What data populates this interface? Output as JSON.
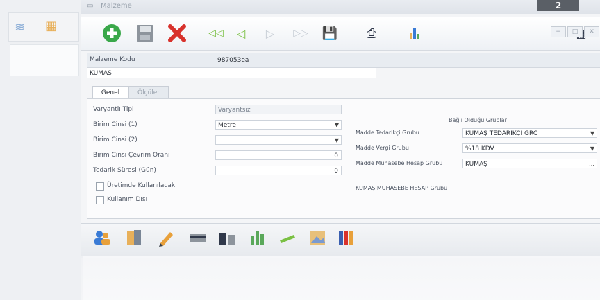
{
  "window": {
    "title": "Malzeme",
    "badge": "2"
  },
  "header": {
    "code_label": "Malzeme Kodu",
    "code_value": "987053ea",
    "name_value": "KUMAŞ"
  },
  "tabs": [
    {
      "label": "Genel"
    },
    {
      "label": "Ölçüler"
    }
  ],
  "left_form": {
    "variant_type_label": "Varyantlı Tipi",
    "variant_type_value": "Varyantsız",
    "unit1_label": "Birim Cinsi (1)",
    "unit1_value": "Metre",
    "unit2_label": "Birim Cinsi (2)",
    "unit2_value": "",
    "conv_label": "Birim Cinsi Çevrim Oranı",
    "conv_value": "0",
    "lead_label": "Tedarik Süresi (Gün)",
    "lead_value": "0",
    "cb1_label": "Üretimde Kullanılacak",
    "cb2_label": "Kullanım Dışı"
  },
  "right_form": {
    "group_title": "Bağlı Olduğu Gruplar",
    "supply_label": "Madde Tedarikçi Grubu",
    "supply_value": "KUMAŞ TEDARİKÇİ GRC",
    "tax_label": "Madde Vergi Grubu",
    "tax_value": "%18 KDV",
    "acc_label": "Madde Muhasebe Hesap Grubu",
    "acc_value": "KUMAŞ",
    "acc_note": "KUMAŞ MUHASEBE HESAP Grubu"
  },
  "icons": {
    "toolbar": [
      "add-icon",
      "save-icon",
      "delete-icon",
      "first-icon",
      "prev-icon",
      "next-icon",
      "last-icon",
      "disk-icon",
      "printer-icon",
      "chart-icon",
      "calculator-icon"
    ],
    "bottom": [
      "users-icon",
      "documents-icon",
      "pencil-icon",
      "card-icon",
      "scanner-icon",
      "bar-chart-icon",
      "pen-icon",
      "image-icon",
      "books-icon"
    ]
  },
  "colors": {
    "accent_green": "#3aa84a",
    "delete_red": "#d8322c",
    "nav_green": "#7ac043"
  }
}
